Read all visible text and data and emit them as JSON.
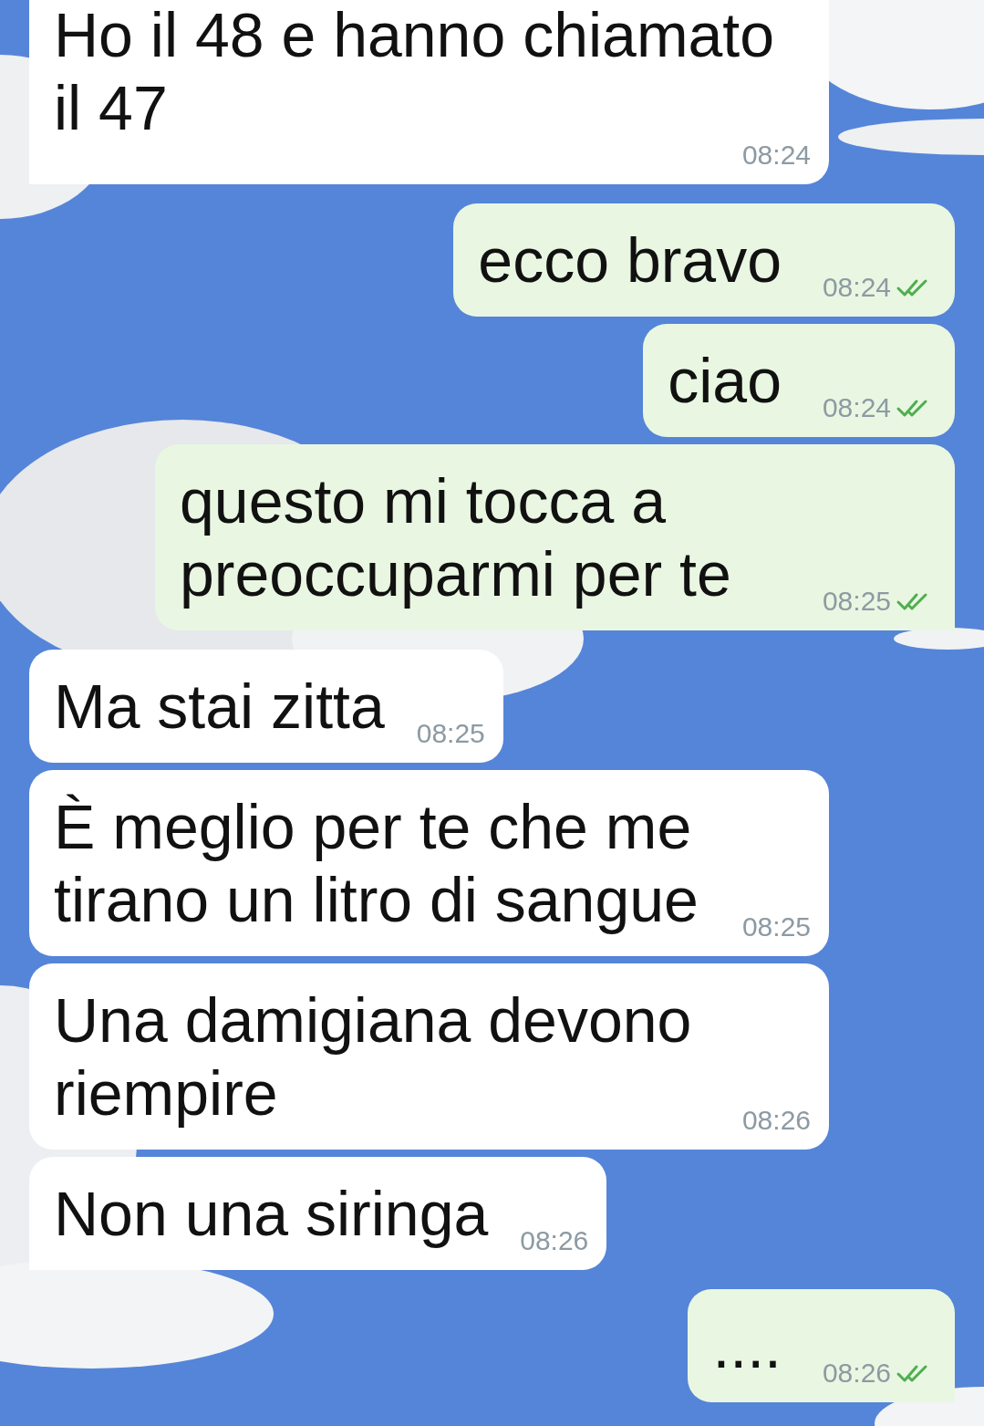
{
  "messages": [
    {
      "kind": "them",
      "text": "Ho il 48 e hanno chiamato il 47",
      "time": "08:24",
      "tail": true
    },
    {
      "kind": "me",
      "text": "ecco bravo",
      "time": "08:24",
      "tail": false
    },
    {
      "kind": "me",
      "text": "ciao",
      "time": "08:24",
      "tail": false
    },
    {
      "kind": "me",
      "text": "questo mi tocca a preoccuparmi per te",
      "time": "08:25",
      "tail": true
    },
    {
      "kind": "them",
      "text": "Ma stai zitta",
      "time": "08:25",
      "tail": false
    },
    {
      "kind": "them",
      "text": "È meglio per te che me tirano un litro di sangue",
      "time": "08:25",
      "tail": false
    },
    {
      "kind": "them",
      "text": "Una damigiana devono riempire",
      "time": "08:26",
      "tail": false
    },
    {
      "kind": "them",
      "text": "Non una siringa",
      "time": "08:26",
      "tail": true
    },
    {
      "kind": "me",
      "text": "....",
      "time": "08:26",
      "tail": true
    }
  ]
}
